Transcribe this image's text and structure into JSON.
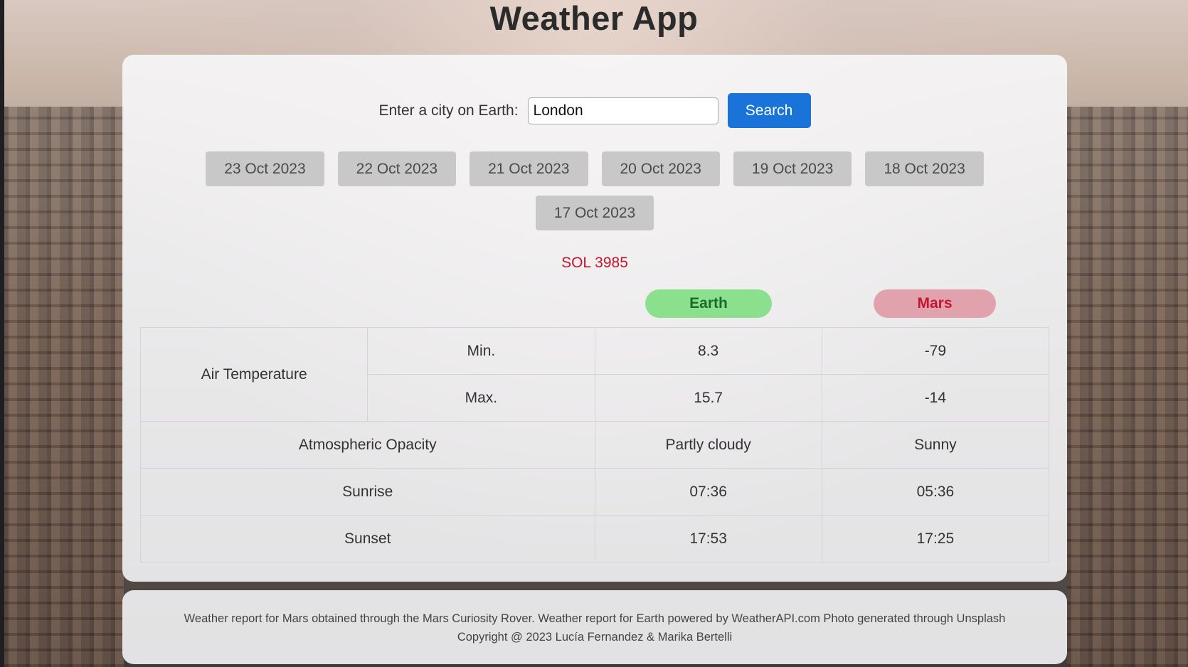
{
  "app": {
    "title": "Weather App"
  },
  "search": {
    "label": "Enter a city on Earth:",
    "value": "London",
    "button_label": "Search"
  },
  "dates": [
    "23 Oct 2023",
    "22 Oct 2023",
    "21 Oct 2023",
    "20 Oct 2023",
    "19 Oct 2023",
    "18 Oct 2023",
    "17 Oct 2023"
  ],
  "sol_label": "SOL 3985",
  "planets": {
    "earth": "Earth",
    "mars": "Mars"
  },
  "table": {
    "air_temperature": {
      "label": "Air Temperature",
      "min": {
        "label": "Min.",
        "earth": "8.3",
        "mars": "-79"
      },
      "max": {
        "label": "Max.",
        "earth": "15.7",
        "mars": "-14"
      }
    },
    "opacity": {
      "label": "Atmospheric Opacity",
      "earth": "Partly cloudy",
      "mars": "Sunny"
    },
    "sunrise": {
      "label": "Sunrise",
      "earth": "07:36",
      "mars": "05:36"
    },
    "sunset": {
      "label": "Sunset",
      "earth": "17:53",
      "mars": "17:25"
    }
  },
  "footer": {
    "credits": "Weather report for Mars obtained through the Mars Curiosity Rover. Weather report for Earth powered by WeatherAPI.com Photo generated through Unsplash",
    "copyright": "Copyright @ 2023 Lucía Fernandez & Marika Bertelli"
  },
  "colors": {
    "search_button": "#1a73d9",
    "earth_pill": "#8be08e",
    "mars_pill": "#e0a3ae",
    "sol_text": "#c4142f"
  }
}
